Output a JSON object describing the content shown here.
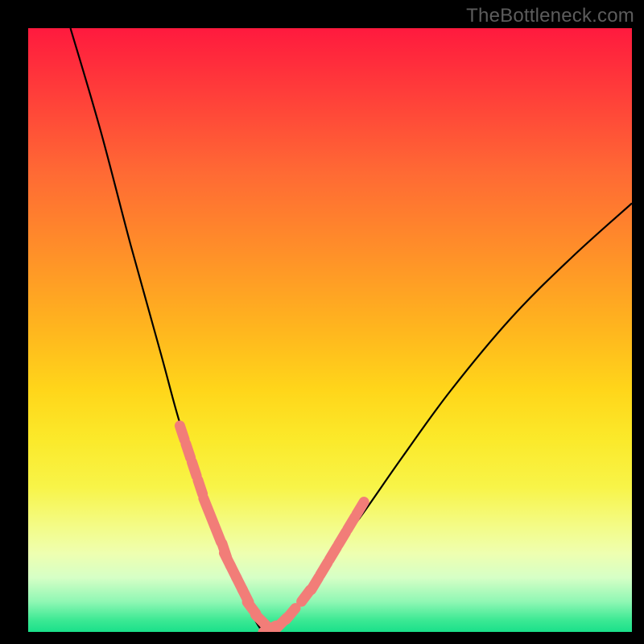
{
  "watermark": "TheBottleneck.com",
  "chart_data": {
    "type": "line",
    "title": "",
    "xlabel": "",
    "ylabel": "",
    "xlim": [
      0,
      100
    ],
    "ylim": [
      0,
      100
    ],
    "series": [
      {
        "name": "bottleneck-curve",
        "x": [
          7,
          12,
          17,
          22,
          25,
          28,
          31,
          33,
          35,
          37,
          39,
          41,
          45,
          49,
          55,
          62,
          70,
          80,
          90,
          100
        ],
        "values": [
          100,
          83,
          64,
          46,
          35,
          26,
          18,
          12,
          7,
          3,
          0,
          0,
          5,
          11,
          19,
          29,
          40,
          52,
          62,
          71
        ]
      },
      {
        "name": "dot-markers",
        "x": [
          25.5,
          26.5,
          27.5,
          28.5,
          29.5,
          30.5,
          31.5,
          32.5,
          33.0,
          34.0,
          35.0,
          36.0,
          37.0,
          38.5,
          40.0,
          42.0,
          43.5,
          46.0,
          47.5,
          49.0,
          50.5,
          52.0,
          53.5,
          55.0
        ],
        "values": [
          33.0,
          30.0,
          27.0,
          24.0,
          21.0,
          18.5,
          16.0,
          13.5,
          12.0,
          10.0,
          8.0,
          6.0,
          4.0,
          2.0,
          0.5,
          1.5,
          3.0,
          6.0,
          8.0,
          10.5,
          13.0,
          15.5,
          18.0,
          20.5
        ]
      }
    ],
    "annotations": [],
    "legend": false,
    "grid": false,
    "background_gradient": {
      "from": "#ff1a3e",
      "to": "#1ae08a",
      "direction": "vertical"
    }
  },
  "colors": {
    "curve": "#000000",
    "marker_fill": "#f27d78",
    "marker_stroke": "#f27d78",
    "frame": "#000000"
  }
}
